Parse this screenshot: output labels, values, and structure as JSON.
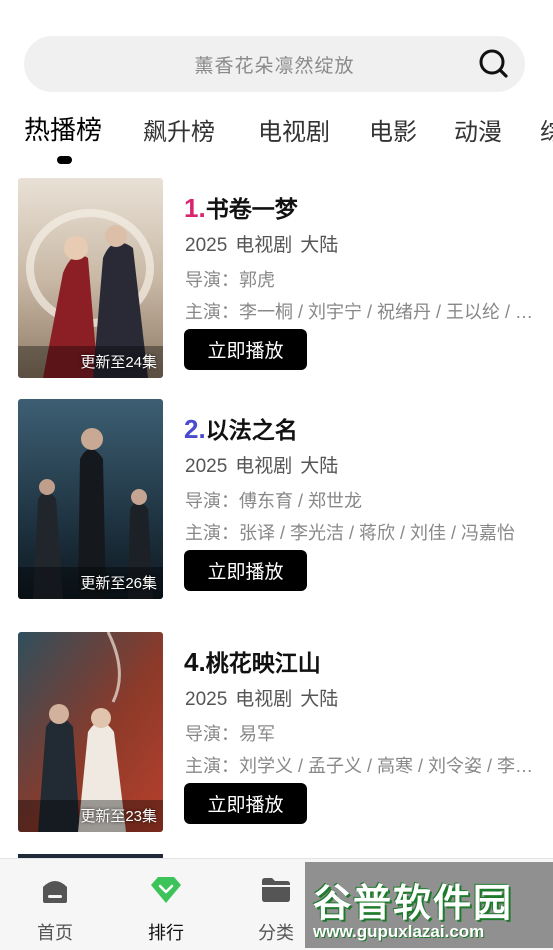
{
  "search": {
    "placeholder": "薰香花朵凛然绽放",
    "icon": "search-icon"
  },
  "tabs": [
    "热播榜",
    "飙升榜",
    "电视剧",
    "电影",
    "动漫",
    "综"
  ],
  "active_tab": "热播榜",
  "items": [
    {
      "rank": "1.",
      "rank_color": "#d9256f",
      "title": "书卷一梦",
      "year": "2025",
      "genre": "电视剧",
      "region": "大陆",
      "director": "导演：郭虎",
      "cast": "主演：李一桐 / 刘宇宁 / 祝绪丹 / 王以纶 / 孟子义",
      "badge": "更新至24集",
      "play_label": "立即播放"
    },
    {
      "rank": "2.",
      "rank_color": "#4a4ad0",
      "title": "以法之名",
      "year": "2025",
      "genre": "电视剧",
      "region": "大陆",
      "director": "导演：傅东育 / 郑世龙",
      "cast": "主演：张译 / 李光洁 / 蒋欣 / 刘佳 / 冯嘉怡",
      "badge": "更新至26集",
      "play_label": "立即播放"
    },
    {
      "rank": "4.",
      "rank_color": "#111111",
      "title": "桃花映江山",
      "year": "2025",
      "genre": "电视剧",
      "region": "大陆",
      "director": "导演：易军",
      "cast": "主演：刘学义 / 孟子义 / 高寒 / 刘令姿 / 李泽锋",
      "badge": "更新至23集",
      "play_label": "立即播放"
    }
  ],
  "bottom_nav": [
    {
      "label": "首页",
      "icon": "home-icon"
    },
    {
      "label": "排行",
      "icon": "ranking-diamond-icon"
    },
    {
      "label": "分类",
      "icon": "folder-icon"
    }
  ],
  "active_nav": "排行",
  "watermark": {
    "main": "谷普软件园",
    "url": "www.gupuxlazai.com"
  },
  "colors": {
    "accent_green": "#3cc45a",
    "button_black": "#000000"
  }
}
